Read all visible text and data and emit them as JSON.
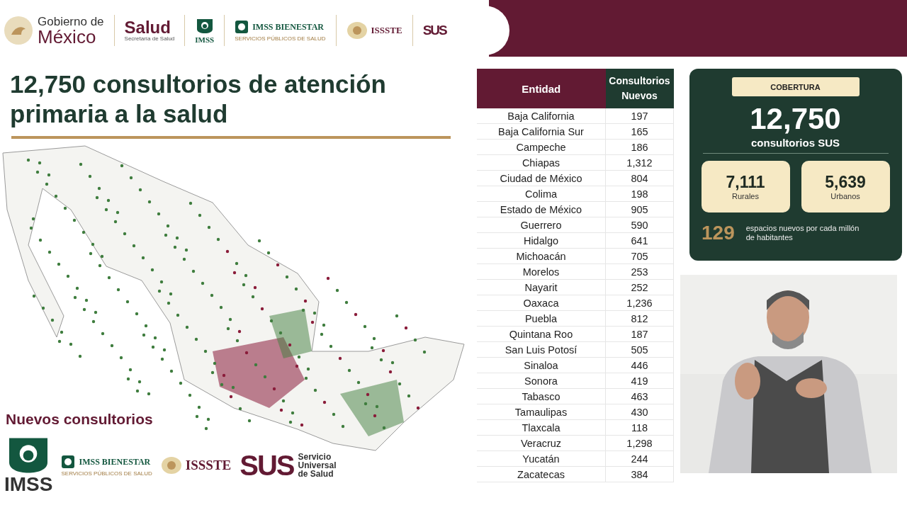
{
  "header": {
    "logos": [
      {
        "kind": "gobierno",
        "lines": [
          "Gobierno de",
          "México"
        ]
      },
      {
        "kind": "salud",
        "lines": [
          "Salud",
          "Secretaría de Salud"
        ]
      },
      {
        "kind": "imss",
        "lines": [
          "IMSS"
        ]
      },
      {
        "kind": "bienestar",
        "lines": [
          "IMSS BIENESTAR",
          "SERVICIOS PÚBLICOS DE SALUD"
        ]
      },
      {
        "kind": "issste",
        "lines": [
          "ISSSTE"
        ]
      },
      {
        "kind": "sus",
        "lines": [
          "SUS"
        ]
      }
    ]
  },
  "title": "12,750 consultorios de atención primaria a la salud",
  "footer": {
    "heading": "Nuevos consultorios",
    "logos": [
      {
        "kind": "imss",
        "lines": [
          "IMSS"
        ]
      },
      {
        "kind": "bienestar",
        "lines": [
          "IMSS BIENESTAR",
          "SERVICIOS PÚBLICOS DE SALUD"
        ]
      },
      {
        "kind": "issste",
        "lines": [
          "ISSSTE"
        ]
      },
      {
        "kind": "sus",
        "lines": [
          "SUS",
          "Servicio",
          "Universal",
          "de Salud"
        ]
      }
    ]
  },
  "table": {
    "columns": [
      "Entidad",
      "Consultorios Nuevos"
    ],
    "rows": [
      [
        "Baja California",
        "197"
      ],
      [
        "Baja California Sur",
        "165"
      ],
      [
        "Campeche",
        "186"
      ],
      [
        "Chiapas",
        "1,312"
      ],
      [
        "Ciudad de México",
        "804"
      ],
      [
        "Colima",
        "198"
      ],
      [
        "Estado de México",
        "905"
      ],
      [
        "Guerrero",
        "590"
      ],
      [
        "Hidalgo",
        "641"
      ],
      [
        "Michoacán",
        "705"
      ],
      [
        "Morelos",
        "253"
      ],
      [
        "Nayarit",
        "252"
      ],
      [
        "Oaxaca",
        "1,236"
      ],
      [
        "Puebla",
        "812"
      ],
      [
        "Quintana Roo",
        "187"
      ],
      [
        "San Luis Potosí",
        "505"
      ],
      [
        "Sinaloa",
        "446"
      ],
      [
        "Sonora",
        "419"
      ],
      [
        "Tabasco",
        "463"
      ],
      [
        "Tamaulipas",
        "430"
      ],
      [
        "Tlaxcala",
        "118"
      ],
      [
        "Veracruz",
        "1,298"
      ],
      [
        "Yucatán",
        "244"
      ],
      [
        "Zacatecas",
        "384"
      ]
    ]
  },
  "summary": {
    "badge": "COBERTURA",
    "total": "12,750",
    "total_label": "consultorios SUS",
    "cards": [
      {
        "value": "7,111",
        "label": "Rurales"
      },
      {
        "value": "5,639",
        "label": "Urbanos"
      }
    ],
    "ratio": "129",
    "ratio_label": "espacios nuevos por cada millón de habitantes"
  }
}
